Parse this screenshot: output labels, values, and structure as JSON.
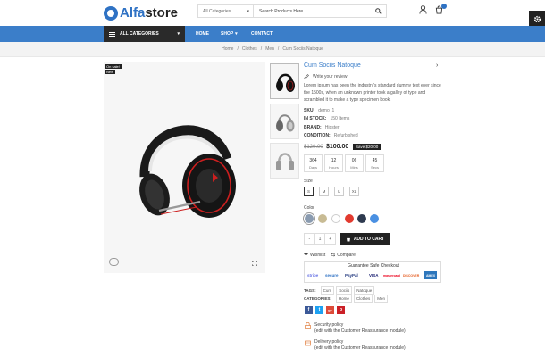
{
  "header": {
    "logo_prefix": "Alfa",
    "logo_suffix": "store",
    "category_select": "All Categories",
    "search_placeholder": "Search Products Here"
  },
  "nav": {
    "all_categories": "ALL CATEGORIES",
    "links": [
      "HOME",
      "SHOP",
      "CONTACT"
    ]
  },
  "breadcrumb": [
    "Home",
    "Clothes",
    "Men",
    "Cum Sociis Natoque"
  ],
  "product": {
    "badges": [
      "On sale!",
      "New"
    ],
    "title": "Cum Sociis Natoque",
    "write_review": "Write your review",
    "description": "Lorem ipsum has been the industry's standard dummy text ever since the 1500s, when an unknown printer took a galley of type and scrambled it to make a type specimen book.",
    "sku_label": "SKU:",
    "sku": "demo_1",
    "stock_label": "IN STOCK:",
    "stock": "150 Items",
    "brand_label": "BRAND:",
    "brand": "Hipster",
    "condition_label": "CONDITION:",
    "condition": "Refurbished",
    "old_price": "$120.00",
    "price": "$100.00",
    "save": "Save $20.00",
    "countdown": [
      {
        "value": "364",
        "unit": "Days"
      },
      {
        "value": "12",
        "unit": "Hours"
      },
      {
        "value": "06",
        "unit": "Mins"
      },
      {
        "value": "45",
        "unit": "Secs"
      }
    ],
    "size_label": "Size",
    "sizes": [
      "S",
      "M",
      "L",
      "XL"
    ],
    "color_label": "Color",
    "colors": [
      "#8a9bb0",
      "#c8bb94",
      "#ffffff",
      "#e23a2f",
      "#2e3a4f",
      "#4a90e2"
    ],
    "quantity": "1",
    "qty_minus": "-",
    "qty_plus": "+",
    "add_to_cart": "ADD TO CART",
    "wishlist": "Wishlist",
    "compare": "Compare",
    "guarantee": "Guarantee Safe Checkout",
    "payment": [
      "stripe",
      "secure",
      "PayPal",
      "VISA",
      "mastercard",
      "DISCOVER",
      "AMEX"
    ],
    "tags_label": "TAGS:",
    "tags": [
      "Cum",
      "Sociis",
      "Natoque"
    ],
    "categories_label": "CATEGORIES:",
    "categories": [
      "Home",
      "Clothes",
      "Men"
    ],
    "social": [
      "f",
      "t",
      "g+",
      "p"
    ],
    "reassurance": [
      {
        "title": "Security policy",
        "sub": "(edit with the Customer Reassurance module)"
      },
      {
        "title": "Delivery policy",
        "sub": "(edit with the Customer Reassurance module)"
      }
    ]
  },
  "colors": {
    "accent": "#3b7ec9",
    "dark": "#222222"
  }
}
